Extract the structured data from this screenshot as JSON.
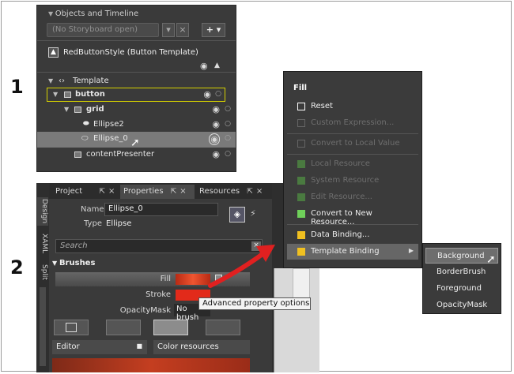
{
  "steps": {
    "one": "1",
    "two": "2"
  },
  "panel1": {
    "header": "Objects and Timeline",
    "storyboard_placeholder": "(No Storyboard open)",
    "style_title": "RedButtonStyle (Button Template)",
    "tree": [
      {
        "label": "Template"
      },
      {
        "label": "button"
      },
      {
        "label": "grid"
      },
      {
        "label": "Ellipse2"
      },
      {
        "label": "Ellipse_0"
      },
      {
        "label": "contentPresenter"
      }
    ]
  },
  "panel2": {
    "tabs": [
      "Project",
      "Properties",
      "Resources"
    ],
    "vtabs": [
      "Design",
      "XAML",
      "Split"
    ],
    "name_label": "Name",
    "name_value": "Ellipse_0",
    "type_label": "Type",
    "type_value": "Ellipse",
    "search_placeholder": "Search",
    "section": "Brushes",
    "brushes": [
      {
        "label": "Fill",
        "color": "#d63a1e"
      },
      {
        "label": "Stroke",
        "color": "#e22a1a"
      },
      {
        "label": "OpacityMask",
        "value": "No brush"
      }
    ],
    "editor_label": "Editor",
    "color_resources": "Color resources",
    "tooltip": "Advanced property options"
  },
  "menu": {
    "title": "Fill",
    "items": [
      {
        "label": "Reset",
        "enabled": true,
        "box": "#ffffff"
      },
      {
        "label": "Custom Expression...",
        "enabled": false,
        "box": "#5a5a5a"
      },
      {
        "label": "Convert to Local Value",
        "enabled": false,
        "box": "#5a5a5a"
      },
      {
        "label": "Local Resource",
        "enabled": false,
        "box": "#4a7a40"
      },
      {
        "label": "System Resource",
        "enabled": false,
        "box": "#4a7a40"
      },
      {
        "label": "Edit Resource...",
        "enabled": false,
        "box": "#4a7a40"
      },
      {
        "label": "Convert to New Resource...",
        "enabled": true,
        "box": "#6fd05a"
      },
      {
        "label": "Data Binding...",
        "enabled": true,
        "box": "#f0c020"
      },
      {
        "label": "Template Binding",
        "enabled": true,
        "box": "#f0c020"
      }
    ],
    "submenu": [
      "Background",
      "BorderBrush",
      "Foreground",
      "OpacityMask"
    ]
  },
  "colors": {
    "accent_red": "#e02020",
    "panel_bg": "#3a3a3a"
  }
}
